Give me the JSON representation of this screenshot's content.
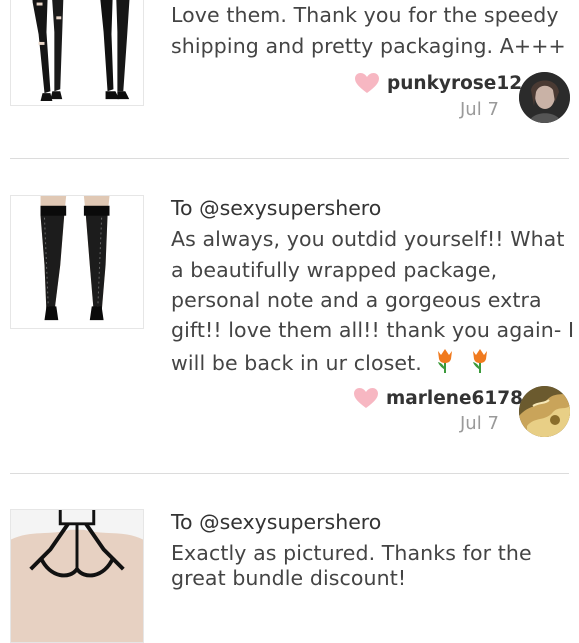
{
  "reviews": [
    {
      "recipient": "",
      "lines": [
        "Love them. Thank you for the speedy",
        "shipping and pretty packaging. A+++"
      ],
      "username": "punkyrose12",
      "date": "Jul 7"
    },
    {
      "recipient": "To @sexysupershero",
      "lines": [
        "As always, you outdid yourself!! What",
        "a beautifully wrapped package,",
        "personal note and a gorgeous extra",
        "gift!! love them all!! thank you again- I",
        "will be back in ur closet."
      ],
      "username": "marlene6178",
      "date": "Jul 7"
    },
    {
      "recipient": "To @sexysupershero",
      "lines": [
        "Exactly as pictured. Thanks for the",
        "great bundle discount!"
      ],
      "username": "",
      "date": ""
    }
  ],
  "icons": {
    "like": "heart-icon",
    "emoji": "tulip-icon"
  },
  "colors": {
    "heart": "#f7b7c2",
    "divider": "#dcdcdc",
    "date": "#9a9a9a"
  }
}
